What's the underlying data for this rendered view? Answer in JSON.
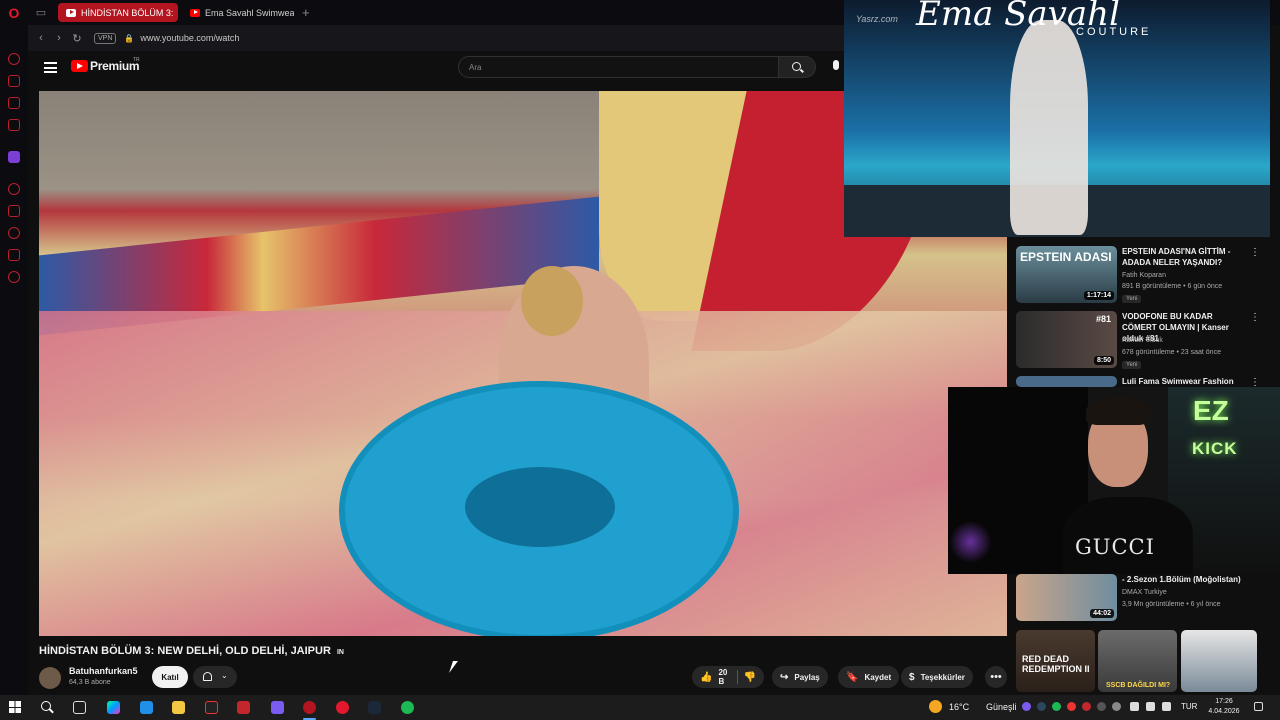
{
  "browser": {
    "tabs": [
      {
        "label": "HİNDİSTAN BÖLÜM 3:",
        "active": true
      },
      {
        "label": "Ema Savahl Swimwear Fa",
        "active": false
      }
    ],
    "new_tab": "+",
    "url": "www.youtube.com/watch",
    "vpn": "VPN"
  },
  "youtube": {
    "brand": "Premium",
    "country": "TR",
    "search_placeholder": "Ara"
  },
  "video": {
    "title": "HİNDİSTAN BÖLÜM 3: NEW DELHİ, OLD DELHİ, JAIPUR",
    "title_suffix": "IN",
    "channel": "Batuhanfurkan5",
    "subscribers": "64,3 B abone",
    "join_label": "Katıl",
    "likes": "20 B",
    "share_label": "Paylaş",
    "save_label": "Kaydet",
    "thanks_label": "Teşekkürler",
    "more": "•••"
  },
  "overlay_top": {
    "watermark": "Yasrz.com",
    "brand": "Ema Savahl",
    "brand_sub": "COUTURE"
  },
  "webcam": {
    "shirt_text": "GUCCI",
    "neon_top": "EZ",
    "neon_bottom": "KICK"
  },
  "related": [
    {
      "title": "EPSTEIN ADASI'NA GİTTİM - ADADA NELER YAŞANDI?",
      "channel": "Fatih Koparan",
      "meta": "891 B görüntüleme • 6 gün önce",
      "badge": "Yeni",
      "duration": "1:17:14",
      "thumb_text": "EPSTEIN ADASI",
      "verified": true
    },
    {
      "title": "VODOFONE BU KADAR CÖMERT OLMAYIN | Kanser olduk #81",
      "channel": "Kanser olduk",
      "meta": "678 görüntüleme • 23 saat önce",
      "badge": "Yeni",
      "duration": "8:50",
      "thumb_text": "#81",
      "verified": false
    },
    {
      "title": "Luli Fama Swimwear Fashion",
      "channel": "",
      "meta": "",
      "badge": "",
      "duration": "",
      "thumb_text": "",
      "verified": false
    },
    {
      "title": "- 2.Sezon 1.Bölüm (Moğolistan)",
      "channel": "DMAX Turkiye",
      "meta": "3,9 Mn görüntüleme • 6 yıl önce",
      "badge": "",
      "duration": "44:02",
      "thumb_text": "",
      "verified": true
    }
  ],
  "bottom_thumbs": [
    {
      "text": "RED DEAD REDEMPTION II"
    },
    {
      "text": "SSCB DAĞILDI MI?"
    },
    {
      "text": ""
    }
  ],
  "taskbar": {
    "temperature": "16°C",
    "condition": "Güneşli",
    "language": "TUR",
    "time": "17:26",
    "date": "4.04.2026"
  }
}
